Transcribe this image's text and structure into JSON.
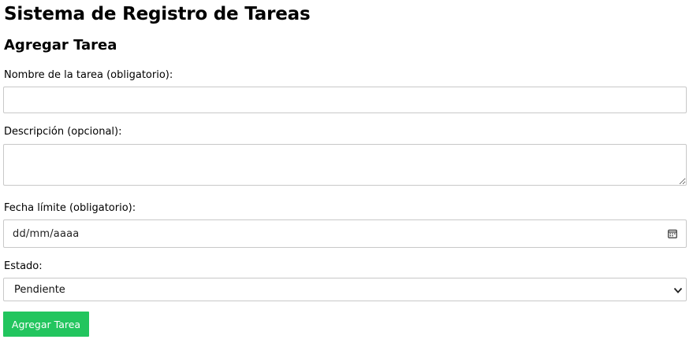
{
  "app_title": "Sistema de Registro de Tareas",
  "form": {
    "title": "Agregar Tarea",
    "name": {
      "label": "Nombre de la tarea (obligatorio):",
      "value": ""
    },
    "description": {
      "label": "Descripción (opcional):",
      "value": ""
    },
    "due_date": {
      "label": "Fecha límite (obligatorio):",
      "placeholder": "dd/mm/aaaa",
      "icon": "calendar-icon"
    },
    "status": {
      "label": "Estado:",
      "selected": "Pendiente",
      "icon": "chevron-down-icon"
    },
    "submit_label": "Agregar Tarea"
  },
  "colors": {
    "button": "#22c55e"
  }
}
